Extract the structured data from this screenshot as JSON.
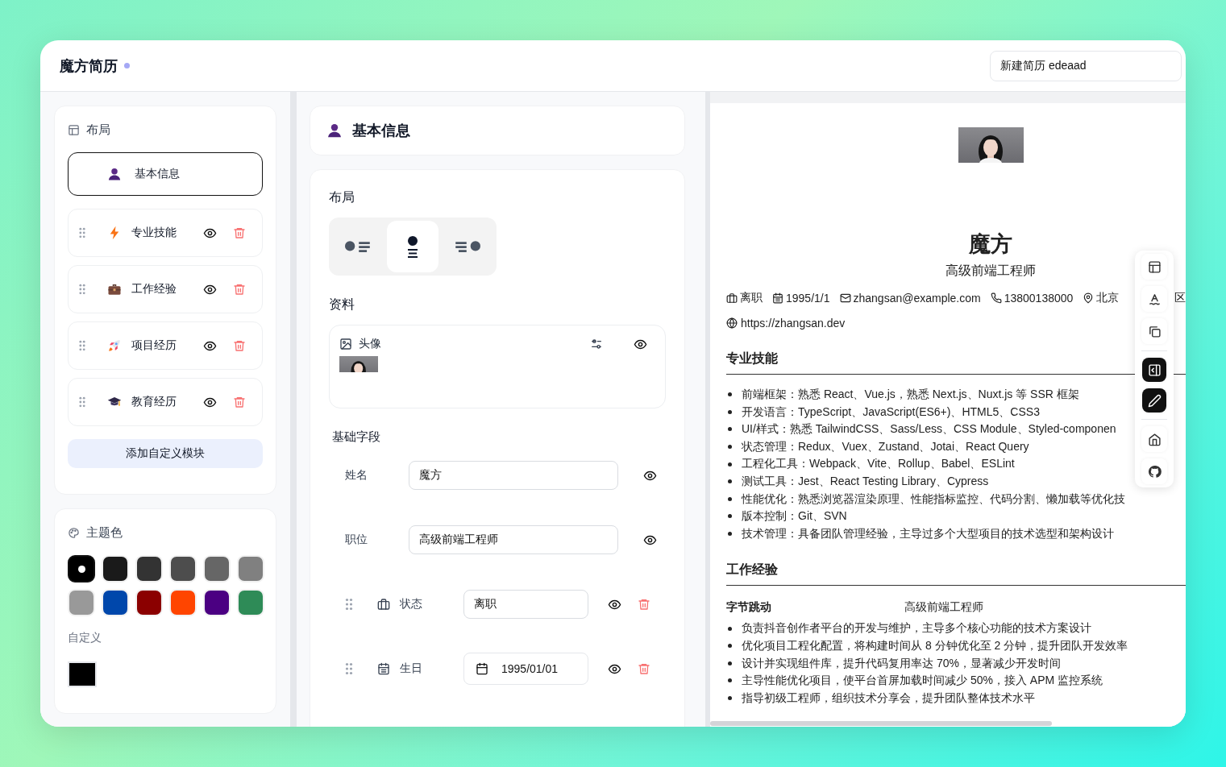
{
  "app": {
    "title": "魔方简历",
    "resume_name": "新建简历 edeaad"
  },
  "sidebar": {
    "layout_title": "布局",
    "modules": [
      {
        "kind": "person",
        "label": "基本信息",
        "selected": true
      },
      {
        "kind": "lightning",
        "label": "专业技能",
        "selected": false
      },
      {
        "kind": "briefcase",
        "label": "工作经验",
        "selected": false
      },
      {
        "kind": "rocket",
        "label": "项目经历",
        "selected": false
      },
      {
        "kind": "cap",
        "label": "教育经历",
        "selected": false
      }
    ],
    "add_button": "添加自定义模块",
    "theme": {
      "title": "主题色",
      "swatches": [
        {
          "color": "#000000",
          "selected": true
        },
        {
          "color": "#1a1a1a",
          "selected": false
        },
        {
          "color": "#333333",
          "selected": false
        },
        {
          "color": "#4d4d4d",
          "selected": false
        },
        {
          "color": "#666666",
          "selected": false
        },
        {
          "color": "#808080",
          "selected": false
        },
        {
          "color": "#999999",
          "selected": false
        },
        {
          "color": "#0047ab",
          "selected": false
        },
        {
          "color": "#8b0000",
          "selected": false
        },
        {
          "color": "#ff4500",
          "selected": false
        },
        {
          "color": "#4b0082",
          "selected": false
        },
        {
          "color": "#2e8b57",
          "selected": false
        }
      ],
      "custom_label": "自定义"
    }
  },
  "editor": {
    "title": "基本信息",
    "layout_title": "布局",
    "layout_options": [
      {
        "kind": "left",
        "selected": false
      },
      {
        "kind": "center",
        "selected": true
      },
      {
        "kind": "right",
        "selected": false
      }
    ],
    "profile_title": "资料",
    "avatar_label": "头像",
    "fields_title": "基础字段",
    "fields": [
      {
        "kind": "fixed",
        "label": "姓名",
        "value": "魔方"
      },
      {
        "kind": "fixed",
        "label": "职位",
        "value": "高级前端工程师"
      },
      {
        "kind": "status",
        "label": "状态",
        "value": "离职"
      },
      {
        "kind": "date",
        "label": "生日",
        "value": "1995/01/01"
      }
    ]
  },
  "preview": {
    "name": "魔方",
    "title": "高级前端工程师",
    "contacts": [
      {
        "kind": "status",
        "text": "离职"
      },
      {
        "kind": "birthday",
        "text": "1995/1/1"
      },
      {
        "kind": "email",
        "text": "zhangsan@example.com"
      },
      {
        "kind": "phone",
        "text": "13800138000"
      },
      {
        "kind": "location",
        "text": "北京",
        "tail": "区"
      }
    ],
    "website": "https://zhangsan.dev",
    "skills": {
      "title": "专业技能",
      "items": [
        "前端框架：熟悉 React、Vue.js，熟悉 Next.js、Nuxt.js 等 SSR 框架",
        "开发语言：TypeScript、JavaScript(ES6+)、HTML5、CSS3",
        "UI/样式：熟悉 TailwindCSS、Sass/Less、CSS Module、Styled-componen",
        "状态管理：Redux、Vuex、Zustand、Jotai、React Query",
        "工程化工具：Webpack、Vite、Rollup、Babel、ESLint",
        "测试工具：Jest、React Testing Library、Cypress",
        "性能优化：熟悉浏览器渲染原理、性能指标监控、代码分割、懒加载等优化技",
        "版本控制：Git、SVN",
        "技术管理：具备团队管理经验，主导过多个大型项目的技术选型和架构设计"
      ]
    },
    "work": {
      "title": "工作经验",
      "company": "字节跳动",
      "role": "高级前端工程师",
      "items": [
        "负责抖音创作者平台的开发与维护，主导多个核心功能的技术方案设计",
        "优化项目工程化配置，将构建时间从 8 分钟优化至 2 分钟，提升团队开发效率",
        "设计并实现组件库，提升代码复用率达 70%，显著减少开发时间",
        "主导性能优化项目，使平台首屏加载时间减少 50%，接入 APM 监控系统",
        "指导初级工程师，组织技术分享会，提升团队整体技术水平"
      ]
    }
  },
  "toolbar": [
    {
      "kind": "layout",
      "active": false
    },
    {
      "kind": "font",
      "active": false
    },
    {
      "kind": "copy",
      "active": false
    },
    {
      "kind": "divider"
    },
    {
      "kind": "panel",
      "active": true
    },
    {
      "kind": "pen",
      "active": true
    },
    {
      "kind": "divider"
    },
    {
      "kind": "home",
      "active": false
    },
    {
      "kind": "github",
      "active": false
    }
  ]
}
